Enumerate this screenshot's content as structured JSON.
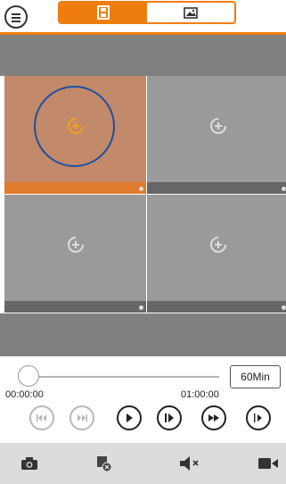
{
  "toolbar": {
    "menu_icon": "menu-icon",
    "tabs": [
      {
        "icon": "live-grid-icon",
        "active": true
      },
      {
        "icon": "image-icon",
        "active": false
      }
    ]
  },
  "grid": {
    "cells": [
      {
        "icon": "add-camera-icon",
        "selected": true
      },
      {
        "icon": "add-camera-icon",
        "selected": false
      },
      {
        "icon": "add-camera-icon",
        "selected": false
      },
      {
        "icon": "add-camera-icon",
        "selected": false
      }
    ]
  },
  "timeline": {
    "start_time": "00:00:00",
    "end_time": "01:00:00",
    "duration_label": "60Min",
    "position": 0
  },
  "playback": {
    "buttons": [
      {
        "icon": "skip-back-icon",
        "enabled": false
      },
      {
        "icon": "skip-forward-icon",
        "enabled": false
      },
      {
        "icon": "play-icon",
        "enabled": true
      },
      {
        "icon": "step-forward-icon",
        "enabled": true
      },
      {
        "icon": "fast-forward-icon",
        "enabled": true
      },
      {
        "icon": "slow-play-icon",
        "enabled": true
      }
    ]
  },
  "bottom_toolbar": [
    {
      "icon": "camera-snapshot-icon"
    },
    {
      "icon": "close-all-icon"
    },
    {
      "icon": "mute-icon"
    },
    {
      "icon": "record-icon"
    }
  ],
  "colors": {
    "accent": "#ef7d0e",
    "selection_ring": "#1f4fa1",
    "add_icon_active": "#f0a020",
    "add_icon_inactive": "#dddddd"
  }
}
